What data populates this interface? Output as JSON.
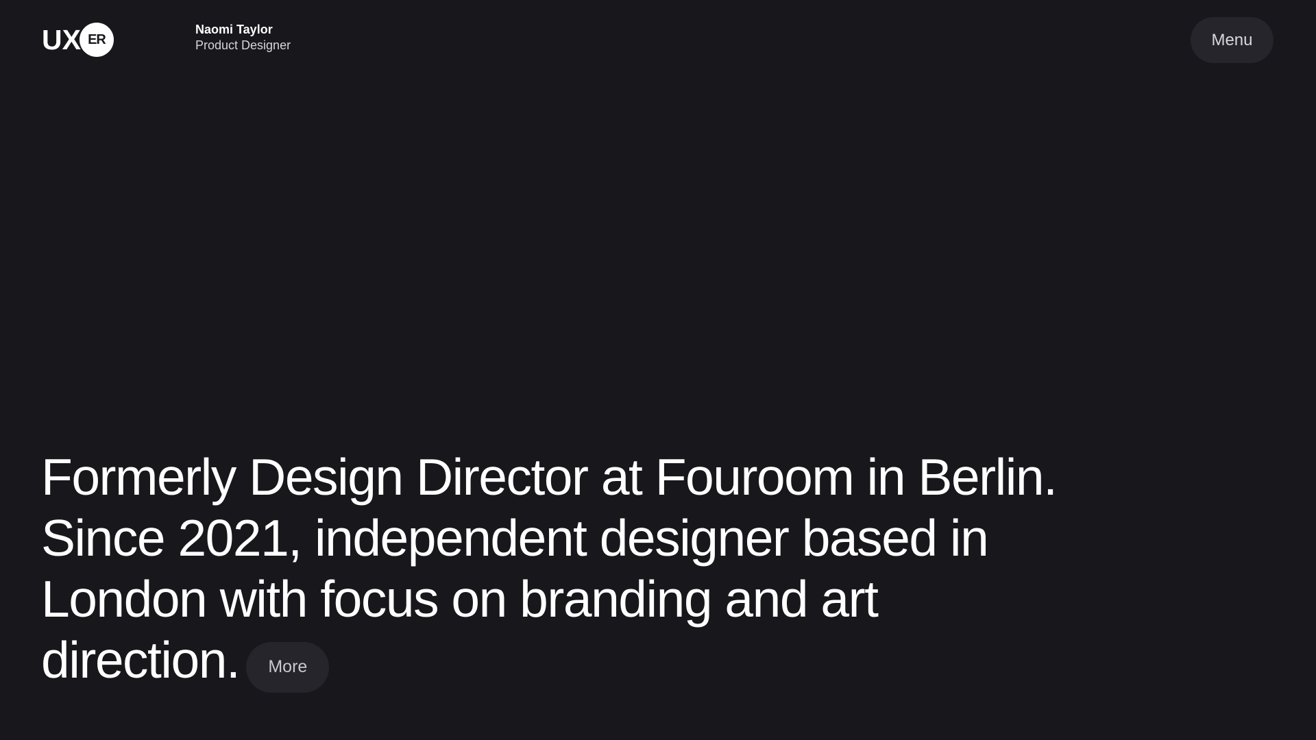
{
  "header": {
    "logo_text": "UX",
    "logo_badge": "ER",
    "name": "Naomi Taylor",
    "role": "Product Designer",
    "menu_label": "Menu"
  },
  "hero": {
    "line1": "Formerly Design Director at Fouroom in Berlin.",
    "line2": "Since 2021, independent designer based in",
    "line3": "London with focus on branding and art",
    "line4": "direction.",
    "more_label": "More"
  },
  "colors": {
    "background": "#18171c",
    "text": "#ffffff",
    "button_bg": "#26252b"
  }
}
